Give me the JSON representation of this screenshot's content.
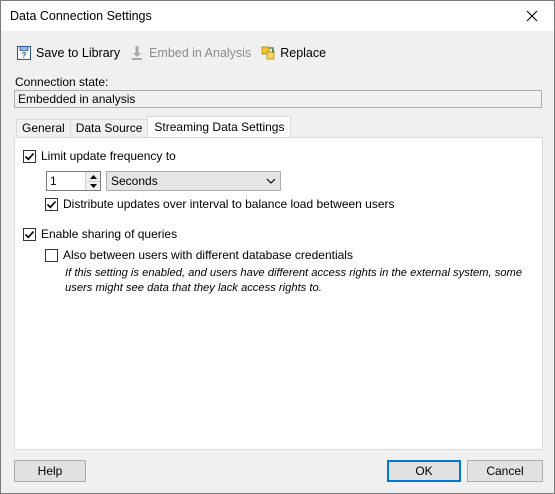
{
  "window": {
    "title": "Data Connection Settings",
    "close_glyph": "✕"
  },
  "toolbar": {
    "save_label": "Save to Library",
    "embed_label": "Embed in Analysis",
    "replace_label": "Replace",
    "icons": {
      "save": "save-library-icon",
      "embed": "embed-icon",
      "replace": "replace-icon"
    }
  },
  "connection": {
    "label": "Connection state:",
    "value": "Embedded in analysis"
  },
  "tabs": [
    {
      "label": "General",
      "active": false
    },
    {
      "label": "Data Source",
      "active": false
    },
    {
      "label": "Streaming Data Settings",
      "active": true
    }
  ],
  "streaming": {
    "limit_label": "Limit update frequency to",
    "limit_checked": true,
    "frequency_value": "1",
    "unit_value": "Seconds",
    "distribute_label": "Distribute updates over interval to balance load between users",
    "distribute_checked": true,
    "sharing_label": "Enable sharing of queries",
    "sharing_checked": true,
    "also_label": "Also between users with different database credentials",
    "also_checked": false,
    "note": "If this setting is enabled, and users have different access rights in the external system, some users might see data that they lack access rights to."
  },
  "buttons": {
    "help": "Help",
    "ok": "OK",
    "cancel": "Cancel"
  },
  "colors": {
    "accent": "#0078d7",
    "disabled_text": "#8d8d8d",
    "panel_bg": "#ffffff",
    "window_bg": "#f0f0f0"
  }
}
